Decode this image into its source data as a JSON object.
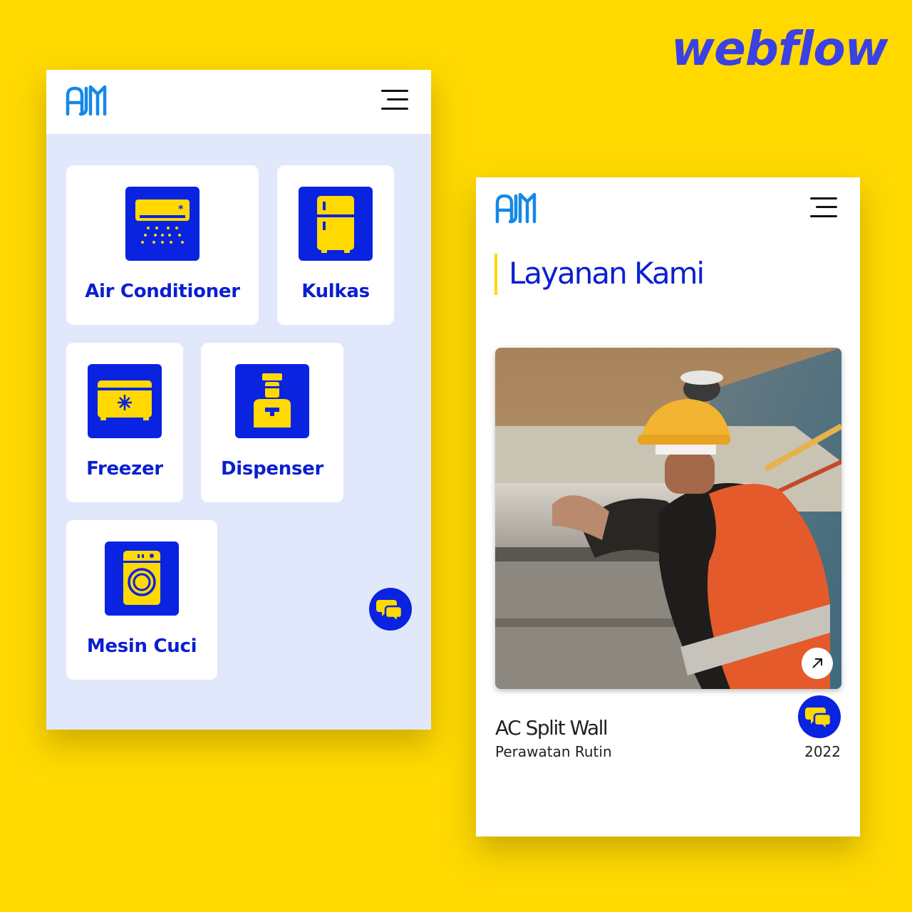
{
  "brand": {
    "wordmark": "webflow"
  },
  "colors": {
    "background": "#FFD900",
    "accent_blue": "#0A23E0",
    "card_yellow": "#FFD900",
    "panel_bg": "#E2E8FB"
  },
  "left_screen": {
    "header": {
      "logo_icon": "ajm-logo-icon",
      "menu_icon": "hamburger-menu-icon"
    },
    "services": [
      {
        "label": "Air Conditioner",
        "icon": "air-conditioner-icon"
      },
      {
        "label": "Kulkas",
        "icon": "refrigerator-icon"
      },
      {
        "label": "Freezer",
        "icon": "freezer-icon"
      },
      {
        "label": "Dispenser",
        "icon": "water-dispenser-icon"
      },
      {
        "label": "Mesin Cuci",
        "icon": "washing-machine-icon"
      }
    ],
    "chat_icon": "chat-bubbles-icon"
  },
  "right_screen": {
    "header": {
      "logo_icon": "ajm-logo-icon",
      "menu_icon": "hamburger-menu-icon"
    },
    "section_title": "Layanan Kami",
    "service_card": {
      "image": "technician-servicing-ac-photo",
      "arrow_icon": "arrow-up-right-icon",
      "name": "AC Split Wall",
      "category": "Perawatan Rutin",
      "year": "2022"
    },
    "chat_icon": "chat-bubbles-icon"
  }
}
